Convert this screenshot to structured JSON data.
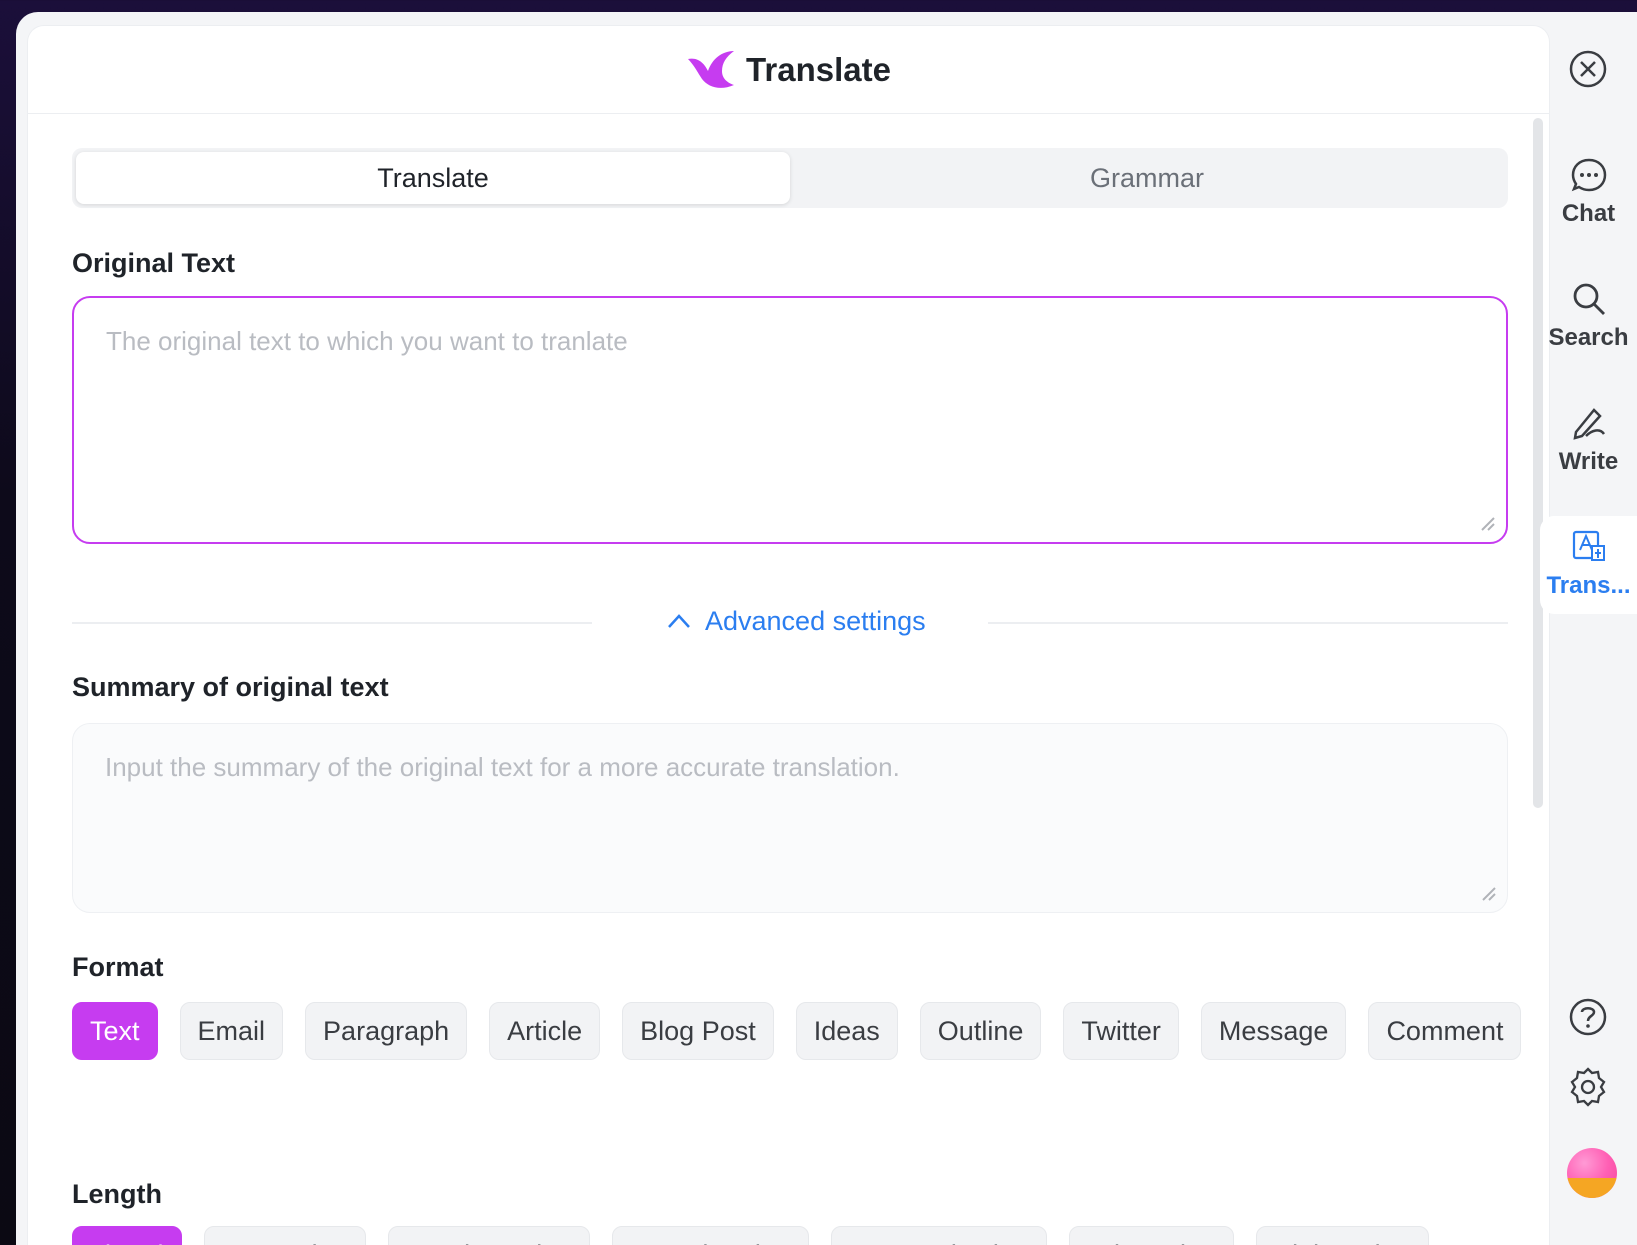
{
  "header": {
    "title": "Translate",
    "logo_icon": "bird-logo-icon",
    "brand_color": "#c63cf0"
  },
  "tabs": [
    {
      "label": "Translate",
      "active": true
    },
    {
      "label": "Grammar",
      "active": false
    }
  ],
  "original": {
    "label": "Original Text",
    "placeholder": "The original text to which you want to tranlate"
  },
  "advanced": {
    "label": "Advanced settings",
    "icon": "chevron-up-icon"
  },
  "summary": {
    "label": "Summary of original text",
    "placeholder": "Input the summary of the original text for a more accurate translation."
  },
  "format": {
    "label": "Format",
    "options": [
      "Text",
      "Email",
      "Paragraph",
      "Article",
      "Blog Post",
      "Ideas",
      "Outline",
      "Twitter",
      "Message",
      "Comment"
    ],
    "selected": "Text"
  },
  "length": {
    "label": "Length",
    "options": [
      "Literal",
      "Expansion",
      "Condensation",
      "Paraphrasing",
      "Summarization",
      "Adaptation",
      "Elaboration"
    ],
    "selected": "Literal"
  },
  "sidebar": {
    "items": [
      {
        "label": "Chat",
        "icon": "chat-icon"
      },
      {
        "label": "Search",
        "icon": "search-icon"
      },
      {
        "label": "Write",
        "icon": "pen-icon"
      },
      {
        "label": "Trans...",
        "icon": "translate-icon",
        "active": true
      }
    ],
    "close_icon": "close-icon",
    "help_icon": "help-icon",
    "settings_icon": "gear-icon"
  },
  "colors": {
    "accent": "#c63cf0",
    "link": "#2b7ef0"
  }
}
